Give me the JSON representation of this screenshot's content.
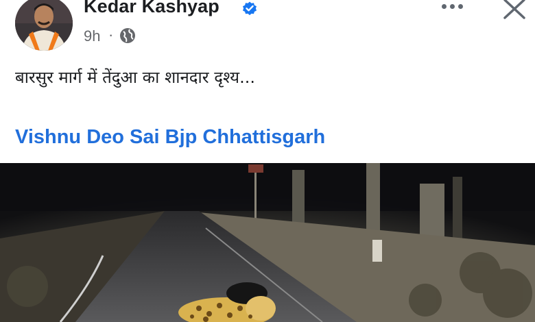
{
  "post": {
    "author_name": "Kedar Kashyap",
    "verified": true,
    "time": "9h",
    "separator": "·",
    "privacy_icon": "globe-icon",
    "text": "बारसुर मार्ग में तेंदुआ का शानदार दृश्य...",
    "link_text": "Vishnu Deo Sai Bjp Chhattisgarh"
  },
  "toolbar": {
    "more_icon": "more-horizontal-icon",
    "close_icon": "close-icon"
  },
  "colors": {
    "name": "#1c1e21",
    "meta": "#65676b",
    "link": "#216fdb",
    "verified": "#1877f2"
  }
}
